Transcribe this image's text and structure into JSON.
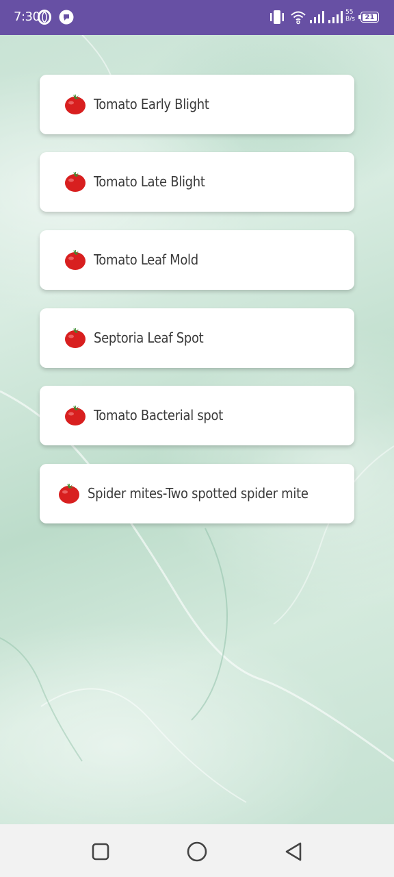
{
  "status_bar": {
    "time": "7:30",
    "network_speed_top": "55",
    "network_speed_bottom": "B/s",
    "battery": "21",
    "icons": [
      "opera-icon",
      "chat-icon",
      "vibrate-icon",
      "wifi-icon",
      "signal-icon",
      "signal-icon",
      "battery-icon"
    ]
  },
  "diseases": [
    {
      "label": "Tomato Early Blight",
      "icon": "tomato-icon"
    },
    {
      "label": "Tomato Late Blight",
      "icon": "tomato-icon"
    },
    {
      "label": "Tomato Leaf Mold",
      "icon": "tomato-icon"
    },
    {
      "label": "Septoria Leaf Spot",
      "icon": "tomato-icon"
    },
    {
      "label": "Tomato Bacterial spot",
      "icon": "tomato-icon"
    },
    {
      "label": "Spider mites-Two spotted spider mite",
      "icon": "tomato-icon"
    }
  ],
  "nav_bar": {
    "buttons": [
      "recents-icon",
      "home-icon",
      "back-icon"
    ]
  },
  "colors": {
    "status_bar": "#6750a4",
    "card": "#ffffff",
    "text": "#3a3a3a",
    "background": "#c9e3d5"
  }
}
